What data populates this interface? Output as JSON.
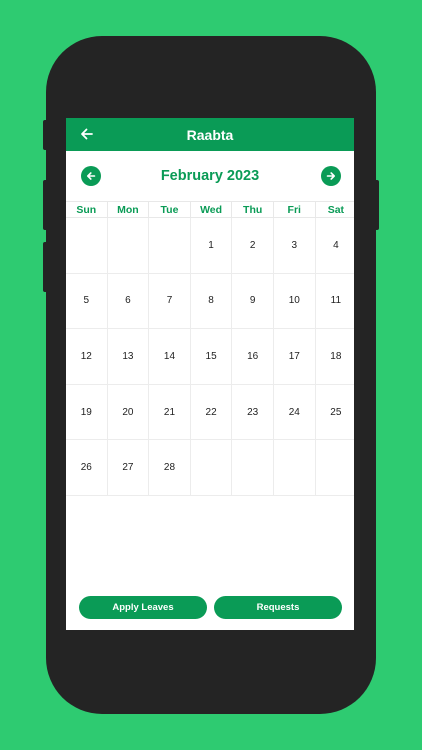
{
  "app": {
    "title": "Raabta"
  },
  "calendar": {
    "month_label": "February 2023",
    "weekdays": [
      "Sun",
      "Mon",
      "Tue",
      "Wed",
      "Thu",
      "Fri",
      "Sat"
    ],
    "leading_blanks": 3,
    "days": [
      "1",
      "2",
      "3",
      "4",
      "5",
      "6",
      "7",
      "8",
      "9",
      "10",
      "11",
      "12",
      "13",
      "14",
      "15",
      "16",
      "17",
      "18",
      "19",
      "20",
      "21",
      "22",
      "23",
      "24",
      "25",
      "26",
      "27",
      "28"
    ]
  },
  "actions": {
    "apply_leaves_label": "Apply Leaves",
    "requests_label": "Requests"
  },
  "colors": {
    "background": "#2ecb71",
    "accent": "#0a9b56",
    "phone_frame": "#242424"
  },
  "icons": {
    "back": "arrow-left-icon",
    "prev": "arrow-left-circle-icon",
    "next": "arrow-right-circle-icon"
  }
}
